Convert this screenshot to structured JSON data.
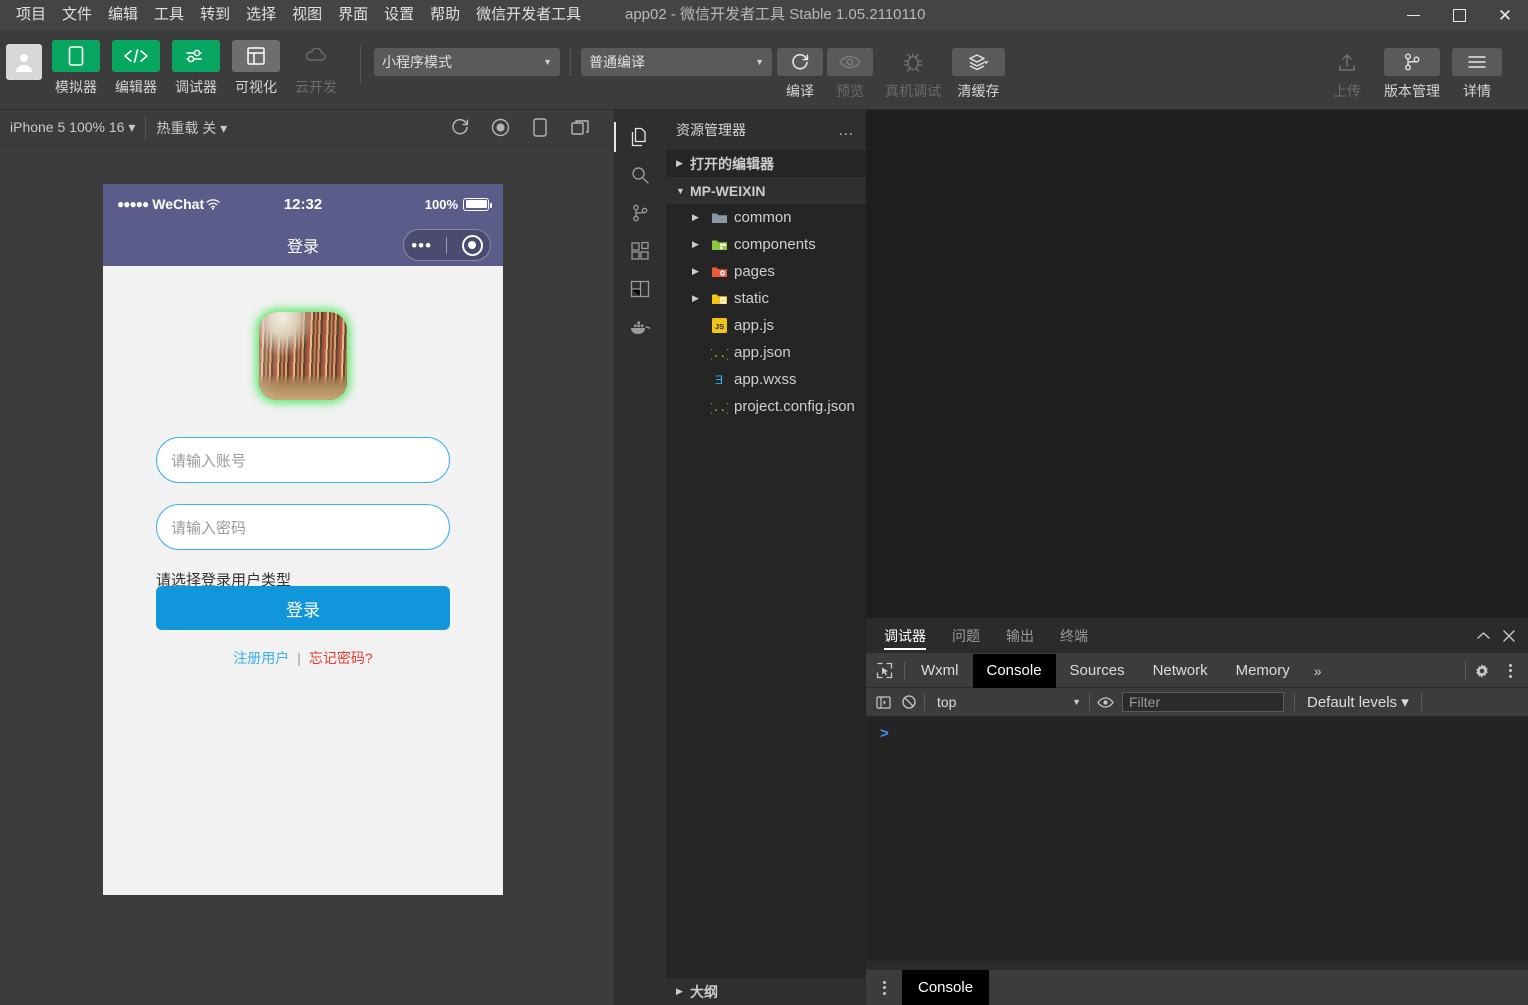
{
  "window": {
    "title": "app02 - 微信开发者工具 Stable 1.05.2110110",
    "menu": [
      "项目",
      "文件",
      "编辑",
      "工具",
      "转到",
      "选择",
      "视图",
      "界面",
      "设置",
      "帮助",
      "微信开发者工具"
    ],
    "controls": {
      "minimize": "minimize-icon",
      "maximize": "maximize-icon",
      "close": "close-icon"
    }
  },
  "toolbar": {
    "avatar": "user-avatar",
    "modes": [
      {
        "label": "模拟器",
        "icon": "phone-icon",
        "state": "active"
      },
      {
        "label": "编辑器",
        "icon": "code-icon",
        "state": "active"
      },
      {
        "label": "调试器",
        "icon": "sliders-icon",
        "state": "active"
      },
      {
        "label": "可视化",
        "icon": "layout-icon",
        "state": "inactive"
      },
      {
        "label": "云开发",
        "icon": "cloud-icon",
        "state": "disabled"
      }
    ],
    "mode_select": "小程序模式",
    "compile_select": "普通编译",
    "actions": [
      {
        "label": "编译",
        "icon": "refresh-icon",
        "state": "enabled"
      },
      {
        "label": "预览",
        "icon": "eye-icon",
        "state": "disabled"
      },
      {
        "label": "真机调试",
        "icon": "bug-icon",
        "state": "disabled"
      },
      {
        "label": "清缓存",
        "icon": "layers-icon",
        "state": "enabled"
      }
    ],
    "right_actions": [
      {
        "label": "上传",
        "icon": "upload-icon",
        "state": "disabled"
      },
      {
        "label": "版本管理",
        "icon": "git-branch-icon",
        "state": "enabled"
      },
      {
        "label": "详情",
        "icon": "menu-icon",
        "state": "enabled"
      }
    ]
  },
  "simulator": {
    "device_select": "iPhone 5 100% 16",
    "hot_reload": "热重载 关",
    "icons": [
      "refresh-icon",
      "record-icon",
      "device-icon",
      "window-icon"
    ],
    "phone": {
      "status": {
        "dots": "●●●●●",
        "carrier": "WeChat",
        "wifi": "wifi-icon",
        "time": "12:32",
        "battery_pct": "100%"
      },
      "nav_title": "登录",
      "capsule": {
        "dots": "•••",
        "circle": "target-icon"
      },
      "logo": "library-bookshelf-photo",
      "account_placeholder": "请输入账号",
      "password_placeholder": "请输入密码",
      "user_type_hint": "请选择登录用户类型",
      "login_button": "登录",
      "register_link": "注册用户",
      "link_separator": "|",
      "forgot_link": "忘记密码?",
      "colors": {
        "nav_bg": "#5c5c8a",
        "primary": "#1296db",
        "link": "#3daff0",
        "danger": "#e83a2c",
        "glow": "#3ce650"
      }
    }
  },
  "activity_bar": [
    {
      "name": "explorer-icon",
      "active": true
    },
    {
      "name": "search-icon",
      "active": false
    },
    {
      "name": "source-control-icon",
      "active": false
    },
    {
      "name": "extensions-icon",
      "active": false
    },
    {
      "name": "layout-icon",
      "active": false
    },
    {
      "name": "docker-icon",
      "active": false
    }
  ],
  "explorer": {
    "title": "资源管理器",
    "more": "...",
    "open_editors": "打开的编辑器",
    "project": "MP-WEIXIN",
    "tree": [
      {
        "label": "common",
        "type": "folder",
        "icon": "folder-plain-icon",
        "expandable": true
      },
      {
        "label": "components",
        "type": "folder",
        "icon": "folder-components-icon",
        "expandable": true
      },
      {
        "label": "pages",
        "type": "folder",
        "icon": "folder-pages-icon",
        "expandable": true
      },
      {
        "label": "static",
        "type": "folder",
        "icon": "folder-static-icon",
        "expandable": true
      },
      {
        "label": "app.js",
        "type": "file",
        "icon": "js-file-icon",
        "expandable": false
      },
      {
        "label": "app.json",
        "type": "file",
        "icon": "json-file-icon",
        "expandable": false
      },
      {
        "label": "app.wxss",
        "type": "file",
        "icon": "css-file-icon",
        "expandable": false
      },
      {
        "label": "project.config.json",
        "type": "file",
        "icon": "json-file-icon",
        "expandable": false
      }
    ],
    "outline": "大纲"
  },
  "debugger": {
    "panel_tabs": [
      {
        "label": "调试器",
        "active": true
      },
      {
        "label": "问题",
        "active": false
      },
      {
        "label": "输出",
        "active": false
      },
      {
        "label": "终端",
        "active": false
      }
    ],
    "panel_controls": [
      "chevron-up-icon",
      "close-icon"
    ],
    "devtools_tabs": [
      {
        "label": "Wxml",
        "active": false
      },
      {
        "label": "Console",
        "active": true
      },
      {
        "label": "Sources",
        "active": false
      },
      {
        "label": "Network",
        "active": false
      },
      {
        "label": "Memory",
        "active": false
      }
    ],
    "overflow": "»",
    "devtools_right": [
      "gear-icon",
      "kebab-icon"
    ],
    "console_bar": {
      "sidebar_toggle": "sidebar-toggle-icon",
      "clear": "clear-console-icon",
      "context": "top",
      "eye": "eye-icon",
      "filter_placeholder": "Filter",
      "levels": "Default levels"
    },
    "prompt": ">",
    "drawer": {
      "kebab": "kebab-icon",
      "tab": "Console"
    }
  }
}
